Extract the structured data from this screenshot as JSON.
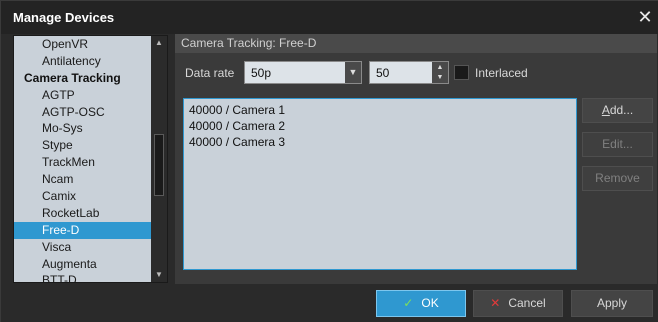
{
  "window": {
    "title": "Manage Devices"
  },
  "device_list": {
    "items": [
      {
        "label": "OpenVR",
        "group": false,
        "selected": false
      },
      {
        "label": "Antilatency",
        "group": false,
        "selected": false
      },
      {
        "label": "Camera Tracking",
        "group": true,
        "selected": false
      },
      {
        "label": "AGTP",
        "group": false,
        "selected": false
      },
      {
        "label": "AGTP-OSC",
        "group": false,
        "selected": false
      },
      {
        "label": "Mo-Sys",
        "group": false,
        "selected": false
      },
      {
        "label": "Stype",
        "group": false,
        "selected": false
      },
      {
        "label": "TrackMen",
        "group": false,
        "selected": false
      },
      {
        "label": "Ncam",
        "group": false,
        "selected": false
      },
      {
        "label": "Camix",
        "group": false,
        "selected": false
      },
      {
        "label": "RocketLab",
        "group": false,
        "selected": false
      },
      {
        "label": "Free-D",
        "group": false,
        "selected": true
      },
      {
        "label": "Visca",
        "group": false,
        "selected": false
      },
      {
        "label": "Augmenta",
        "group": false,
        "selected": false
      },
      {
        "label": "BTT-D",
        "group": false,
        "selected": false
      }
    ]
  },
  "panel": {
    "header": "Camera Tracking: Free-D",
    "data_rate_label": "Data rate",
    "data_rate_value": "50p",
    "rate_number": "50",
    "interlaced_label": "Interlaced",
    "interlaced_checked": false,
    "cameras": [
      "40000 / Camera 1",
      "40000 / Camera 2",
      "40000 / Camera 3"
    ],
    "add_label_ul": "A",
    "add_label_rest": "dd...",
    "edit_label": "Edit...",
    "remove_label": "Remove"
  },
  "footer": {
    "ok_label": "OK",
    "cancel_label": "Cancel",
    "apply_label": "Apply"
  },
  "icons": {
    "close": "close-icon",
    "ok": "check-icon",
    "cancel": "x-icon",
    "dropdown": "chevron-down-icon",
    "spinner": "spin-arrows-icon"
  },
  "colors": {
    "accent": "#2f98d0",
    "list_bg": "#c9d1d9",
    "window_bg": "#2d2d2d",
    "ok_icon": "#7ee05a",
    "cancel_icon": "#e23a3a"
  }
}
